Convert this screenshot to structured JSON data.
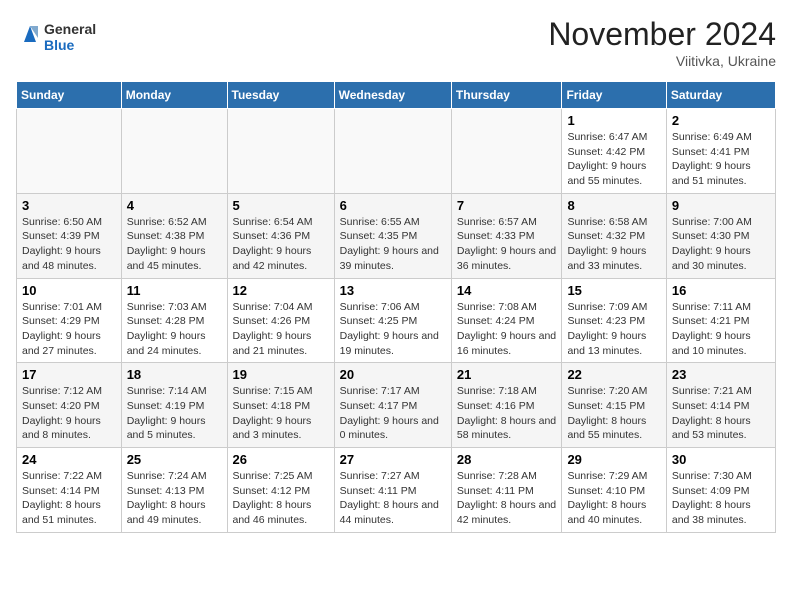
{
  "logo": {
    "line1": "General",
    "line2": "Blue"
  },
  "title": "November 2024",
  "location": "Viitivka, Ukraine",
  "days_of_week": [
    "Sunday",
    "Monday",
    "Tuesday",
    "Wednesday",
    "Thursday",
    "Friday",
    "Saturday"
  ],
  "weeks": [
    [
      {
        "day": "",
        "info": ""
      },
      {
        "day": "",
        "info": ""
      },
      {
        "day": "",
        "info": ""
      },
      {
        "day": "",
        "info": ""
      },
      {
        "day": "",
        "info": ""
      },
      {
        "day": "1",
        "info": "Sunrise: 6:47 AM\nSunset: 4:42 PM\nDaylight: 9 hours and 55 minutes."
      },
      {
        "day": "2",
        "info": "Sunrise: 6:49 AM\nSunset: 4:41 PM\nDaylight: 9 hours and 51 minutes."
      }
    ],
    [
      {
        "day": "3",
        "info": "Sunrise: 6:50 AM\nSunset: 4:39 PM\nDaylight: 9 hours and 48 minutes."
      },
      {
        "day": "4",
        "info": "Sunrise: 6:52 AM\nSunset: 4:38 PM\nDaylight: 9 hours and 45 minutes."
      },
      {
        "day": "5",
        "info": "Sunrise: 6:54 AM\nSunset: 4:36 PM\nDaylight: 9 hours and 42 minutes."
      },
      {
        "day": "6",
        "info": "Sunrise: 6:55 AM\nSunset: 4:35 PM\nDaylight: 9 hours and 39 minutes."
      },
      {
        "day": "7",
        "info": "Sunrise: 6:57 AM\nSunset: 4:33 PM\nDaylight: 9 hours and 36 minutes."
      },
      {
        "day": "8",
        "info": "Sunrise: 6:58 AM\nSunset: 4:32 PM\nDaylight: 9 hours and 33 minutes."
      },
      {
        "day": "9",
        "info": "Sunrise: 7:00 AM\nSunset: 4:30 PM\nDaylight: 9 hours and 30 minutes."
      }
    ],
    [
      {
        "day": "10",
        "info": "Sunrise: 7:01 AM\nSunset: 4:29 PM\nDaylight: 9 hours and 27 minutes."
      },
      {
        "day": "11",
        "info": "Sunrise: 7:03 AM\nSunset: 4:28 PM\nDaylight: 9 hours and 24 minutes."
      },
      {
        "day": "12",
        "info": "Sunrise: 7:04 AM\nSunset: 4:26 PM\nDaylight: 9 hours and 21 minutes."
      },
      {
        "day": "13",
        "info": "Sunrise: 7:06 AM\nSunset: 4:25 PM\nDaylight: 9 hours and 19 minutes."
      },
      {
        "day": "14",
        "info": "Sunrise: 7:08 AM\nSunset: 4:24 PM\nDaylight: 9 hours and 16 minutes."
      },
      {
        "day": "15",
        "info": "Sunrise: 7:09 AM\nSunset: 4:23 PM\nDaylight: 9 hours and 13 minutes."
      },
      {
        "day": "16",
        "info": "Sunrise: 7:11 AM\nSunset: 4:21 PM\nDaylight: 9 hours and 10 minutes."
      }
    ],
    [
      {
        "day": "17",
        "info": "Sunrise: 7:12 AM\nSunset: 4:20 PM\nDaylight: 9 hours and 8 minutes."
      },
      {
        "day": "18",
        "info": "Sunrise: 7:14 AM\nSunset: 4:19 PM\nDaylight: 9 hours and 5 minutes."
      },
      {
        "day": "19",
        "info": "Sunrise: 7:15 AM\nSunset: 4:18 PM\nDaylight: 9 hours and 3 minutes."
      },
      {
        "day": "20",
        "info": "Sunrise: 7:17 AM\nSunset: 4:17 PM\nDaylight: 9 hours and 0 minutes."
      },
      {
        "day": "21",
        "info": "Sunrise: 7:18 AM\nSunset: 4:16 PM\nDaylight: 8 hours and 58 minutes."
      },
      {
        "day": "22",
        "info": "Sunrise: 7:20 AM\nSunset: 4:15 PM\nDaylight: 8 hours and 55 minutes."
      },
      {
        "day": "23",
        "info": "Sunrise: 7:21 AM\nSunset: 4:14 PM\nDaylight: 8 hours and 53 minutes."
      }
    ],
    [
      {
        "day": "24",
        "info": "Sunrise: 7:22 AM\nSunset: 4:14 PM\nDaylight: 8 hours and 51 minutes."
      },
      {
        "day": "25",
        "info": "Sunrise: 7:24 AM\nSunset: 4:13 PM\nDaylight: 8 hours and 49 minutes."
      },
      {
        "day": "26",
        "info": "Sunrise: 7:25 AM\nSunset: 4:12 PM\nDaylight: 8 hours and 46 minutes."
      },
      {
        "day": "27",
        "info": "Sunrise: 7:27 AM\nSunset: 4:11 PM\nDaylight: 8 hours and 44 minutes."
      },
      {
        "day": "28",
        "info": "Sunrise: 7:28 AM\nSunset: 4:11 PM\nDaylight: 8 hours and 42 minutes."
      },
      {
        "day": "29",
        "info": "Sunrise: 7:29 AM\nSunset: 4:10 PM\nDaylight: 8 hours and 40 minutes."
      },
      {
        "day": "30",
        "info": "Sunrise: 7:30 AM\nSunset: 4:09 PM\nDaylight: 8 hours and 38 minutes."
      }
    ]
  ]
}
